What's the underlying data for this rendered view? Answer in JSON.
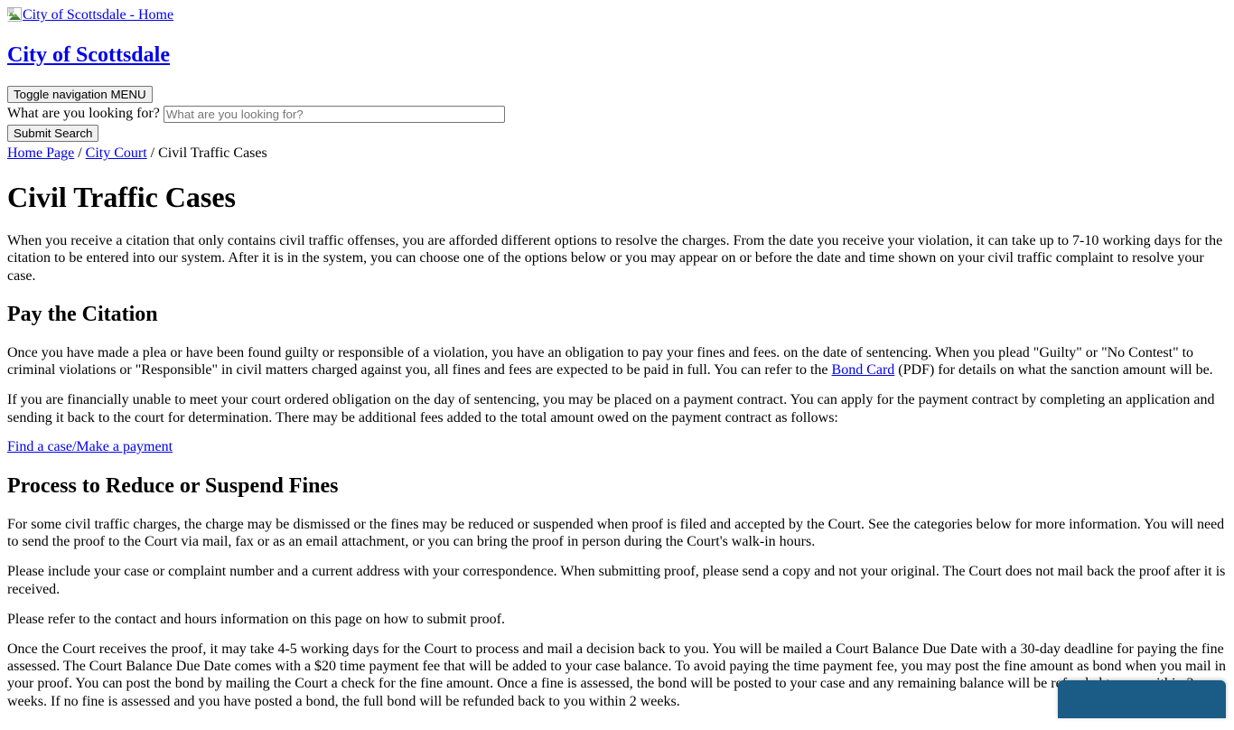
{
  "header": {
    "logo_link_text": "City of Scottsdale - Home",
    "logo_icon": "broken-image-icon",
    "site_title": "City of Scottsdale",
    "nav_toggle_label": "Toggle navigation MENU",
    "search_label": "What are you looking for?",
    "search_placeholder": "What are you looking for?",
    "search_value": "",
    "submit_label": "Submit Search"
  },
  "breadcrumb": {
    "items": [
      {
        "label": "Home Page",
        "link": true
      },
      {
        "label": "City Court",
        "link": true
      },
      {
        "label": "Civil Traffic Cases",
        "link": false
      }
    ],
    "separator": "/"
  },
  "main": {
    "page_title": "Civil Traffic Cases",
    "intro": "When you receive a citation that only contains civil traffic offenses, you are afforded different options to resolve the charges.  From the date you receive your violation, it can take up to 7-10 working days for the citation to be entered into our system.  After it is in the system, you can choose one of the options below or you may appear on or before the date and time shown on your civil traffic complaint to resolve your case.",
    "sections": [
      {
        "title": "Pay the Citation",
        "para1_before_link": "Once you have made a plea or have been found guilty or responsible of a violation, you have an obligation to pay your fines and fees. on the date of sentencing. When you plead \"Guilty\" or \"No Contest\" to criminal violations or \"Responsible\" in civil matters charged against you, all fines and fees are expected to be paid in full. You can refer to the ",
        "para1_link": "Bond Card",
        "para1_after_link": " (PDF) for details on what the sanction amount will be.",
        "para2": "If you are financially unable to meet your court ordered obligation on the day of sentencing, you may be placed on a payment contract.  You can apply for the payment contract by completing an application and sending it back to the court for determination.  There may be additional fees added to the total amount owed on the payment contract as follows:",
        "action_link": "Find a case/Make a payment"
      },
      {
        "title": "Process to Reduce or Suspend Fines",
        "para1": "For some civil traffic charges, the charge may be dismissed or the fines may be reduced or suspended when proof is filed and accepted by the Court. See the categories below for more information.  You will need to send the proof to the Court via mail, fax or as an email attachment, or you can bring the proof in person during the Court's walk-in hours.",
        "para2": "Please include your case or complaint number and a current address with your correspondence.  When submitting proof, please send a copy and not your original. The Court does not mail back the proof after it is received.",
        "para3": "Please refer to the contact and hours information on this page on how to submit proof.",
        "para4": "Once the Court receives the proof, it may take 4-5 working days for the Court to process and mail a decision back to you. You will be mailed a Court Balance Due Date with a 30-day deadline for paying the fine assessed. The Court Balance Due Date comes with a $20 time payment fee that will be added to your case balance. To avoid paying the time payment fee, you may post the fine amount as bond when you mail in your proof. You can post the bond by mailing the Court a check for the fine amount. Once a fine is assessed, the bond will be posted to your case and any remaining balance will be refunded to you within 2 weeks. If no fine is assessed and you have posted a bond, the full bond will be refunded back to you within 2 weeks."
      }
    ]
  },
  "widget": {
    "name": "chat-widget",
    "color": "#1a5c85",
    "label": ""
  },
  "colors": {
    "link": "#0000EE",
    "visited_link": "#551A8B",
    "text": "#000000",
    "background": "#ffffff",
    "widget_blue": "#1a5c85"
  }
}
